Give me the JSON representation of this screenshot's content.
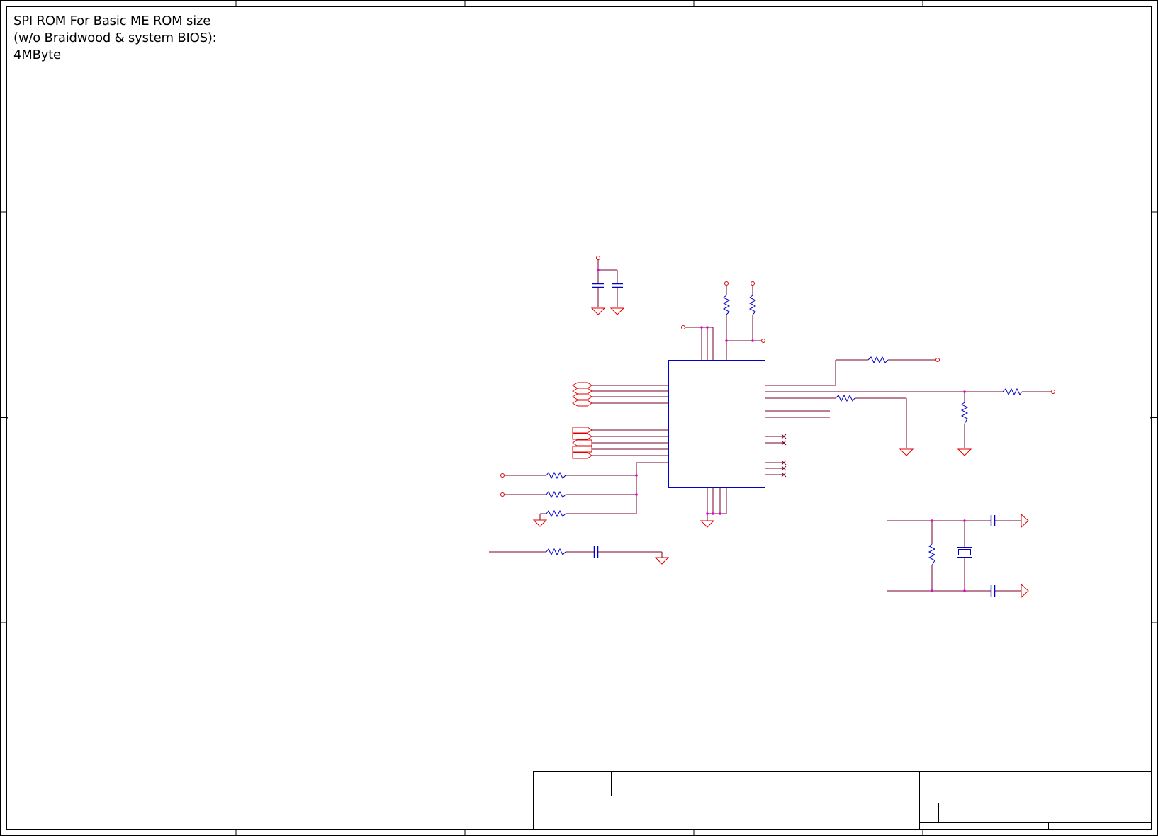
{
  "notes": {
    "line1": "SPI ROM For Basic ME ROM size",
    "line2": "(w/o Braidwood & system BIOS):",
    "line3": "4MByte"
  },
  "colors": {
    "border": "#000000",
    "wire": "#7a0028",
    "pin": "#e00000",
    "component": "#0000cc",
    "junction": "#e000e0"
  },
  "icons": {
    "ground": "ground-icon",
    "resistor": "resistor-icon",
    "capacitor": "capacitor-icon",
    "crystal": "crystal-icon",
    "power-port": "power-port-icon",
    "off-page-connector": "off-page-connector-icon",
    "no-connect": "no-connect-icon"
  }
}
